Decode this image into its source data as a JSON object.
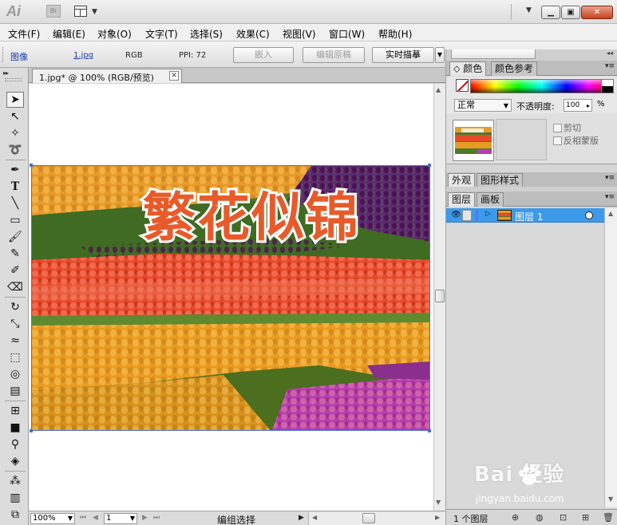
{
  "app": {
    "logo": "Ai",
    "bridge_label": "Br"
  },
  "menu": [
    "文件(F)",
    "编辑(E)",
    "对象(O)",
    "文字(T)",
    "选择(S)",
    "效果(C)",
    "视图(V)",
    "窗口(W)",
    "帮助(H)"
  ],
  "control_bar": {
    "object_type": "图像",
    "file_name": "1.jpg",
    "color_mode": "RGB",
    "ppi": "PPI: 72",
    "embed": "嵌入",
    "edit_original": "编辑原稿",
    "live_trace": "实时描摹"
  },
  "document": {
    "tab_title": "1.jpg* @ 100% (RGB/预览)",
    "image_title": "繁花似锦"
  },
  "status_bar": {
    "zoom": "100%",
    "artboard": "1",
    "status_text": "编组选择"
  },
  "panels": {
    "color_tabs": [
      "颜色",
      "颜色参考"
    ],
    "blend_mode": "正常",
    "opacity_label": "不透明度:",
    "opacity_value": "100",
    "opacity_unit": "%",
    "clip_label": "剪切",
    "invert_mask_label": "反相蒙版",
    "appearance_tabs": [
      "外观",
      "图形样式"
    ],
    "layers_tabs": [
      "图层",
      "画板"
    ],
    "layer_name": "图层 1",
    "layer_count": "1 个图层"
  },
  "watermark": {
    "brand": "Bai  经验",
    "url": "jingyan.baidu.com"
  },
  "colors": {
    "layer_selection": "#3d9aeb",
    "image_title_fill": "#e85a2a",
    "selection_outline": "#4a6fd1"
  }
}
